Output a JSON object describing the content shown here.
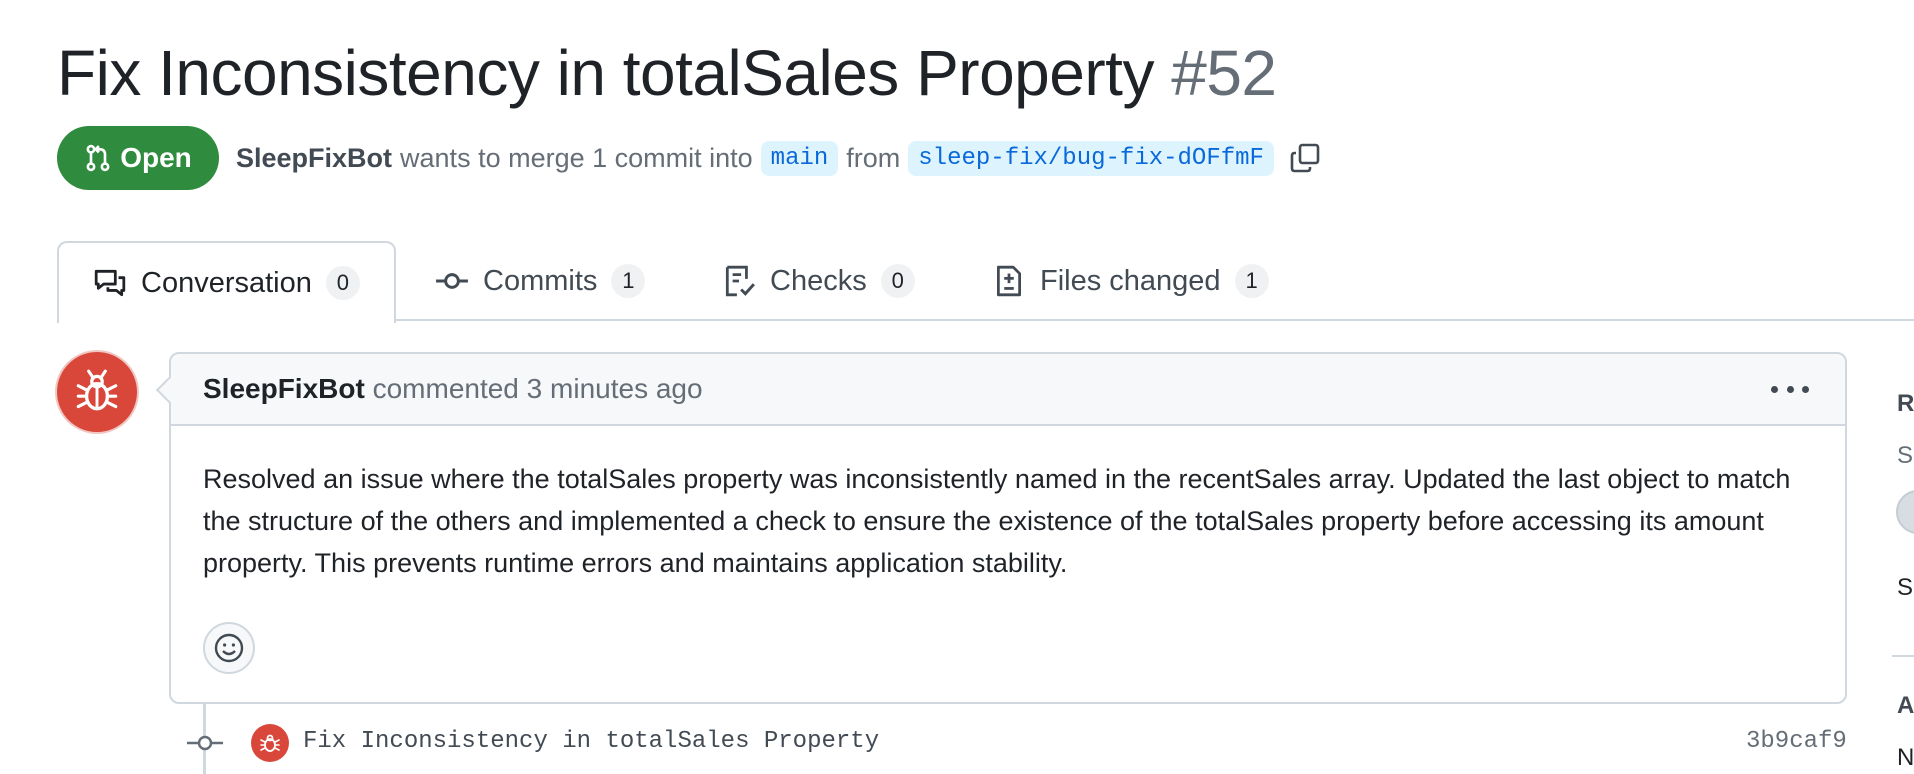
{
  "pr": {
    "title": "Fix Inconsistency in totalSales Property",
    "number": "#52",
    "state": "Open",
    "author": "SleepFixBot",
    "merge_text_1": "wants to merge 1 commit into",
    "base_branch": "main",
    "from_text": "from",
    "head_branch": "sleep-fix/bug-fix-dOFfmF"
  },
  "tabs": [
    {
      "label": "Conversation",
      "count": "0",
      "icon": "comment-discussion-icon"
    },
    {
      "label": "Commits",
      "count": "1",
      "icon": "git-commit-icon"
    },
    {
      "label": "Checks",
      "count": "0",
      "icon": "checklist-icon"
    },
    {
      "label": "Files changed",
      "count": "1",
      "icon": "file-diff-icon"
    }
  ],
  "comment": {
    "author": "SleepFixBot",
    "action": "commented",
    "time": "3 minutes ago",
    "body": "Resolved an issue where the totalSales property was inconsistently named in the recentSales array. Updated the last object to match the structure of the others and implemented a check to ensure the existence of the totalSales property before accessing its amount property. This prevents runtime errors and maintains application stability."
  },
  "commit": {
    "message": "Fix Inconsistency in totalSales Property",
    "sha": "3b9caf9"
  },
  "sidebar": {
    "reviewers_fragment": "R",
    "suggestions_fragment": "S",
    "still_fragment": "S",
    "assignees_fragment": "A",
    "no_fragment": "N"
  },
  "colors": {
    "open_green": "#2f8b3e",
    "link_blue": "#0969da",
    "bot_red": "#d9473b"
  }
}
